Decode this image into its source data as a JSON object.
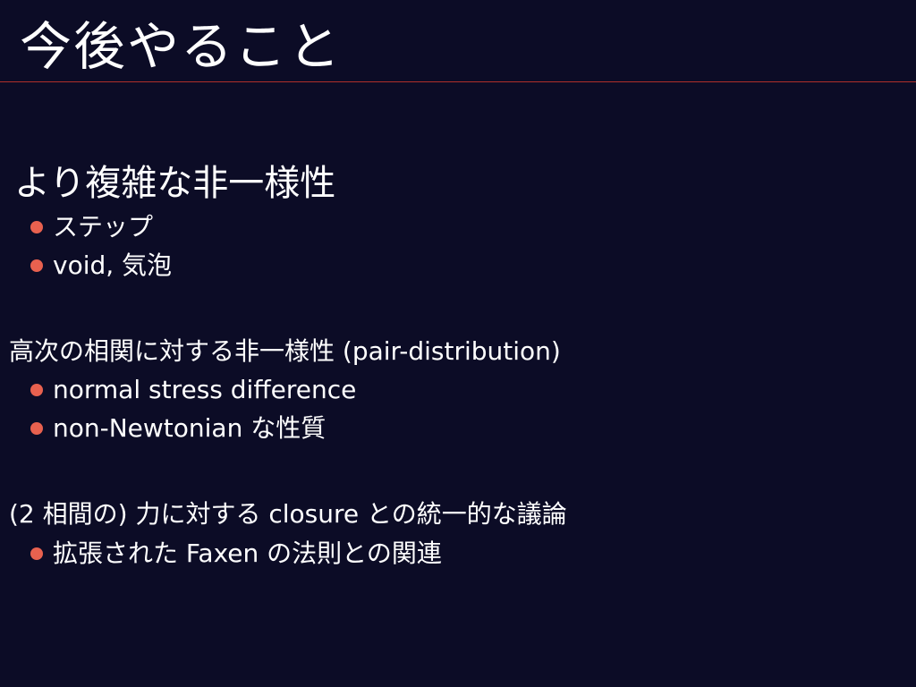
{
  "slide": {
    "title": "今後やること",
    "sections": [
      {
        "heading": "より複雑な非一様性",
        "items": [
          "ステップ",
          "void, 気泡"
        ]
      },
      {
        "heading": "高次の相関に対する非一様性 (pair-distribution)",
        "items": [
          "normal stress difference",
          "non-Newtonian な性質"
        ]
      },
      {
        "heading": "(2 相間の) 力に対する closure との統一的な議論",
        "items": [
          "拡張された Faxen の法則との関連"
        ]
      }
    ]
  },
  "colors": {
    "background": "#0c0c26",
    "text": "#ffffff",
    "bullet": "#e8614f",
    "rule": "#b0302a"
  }
}
